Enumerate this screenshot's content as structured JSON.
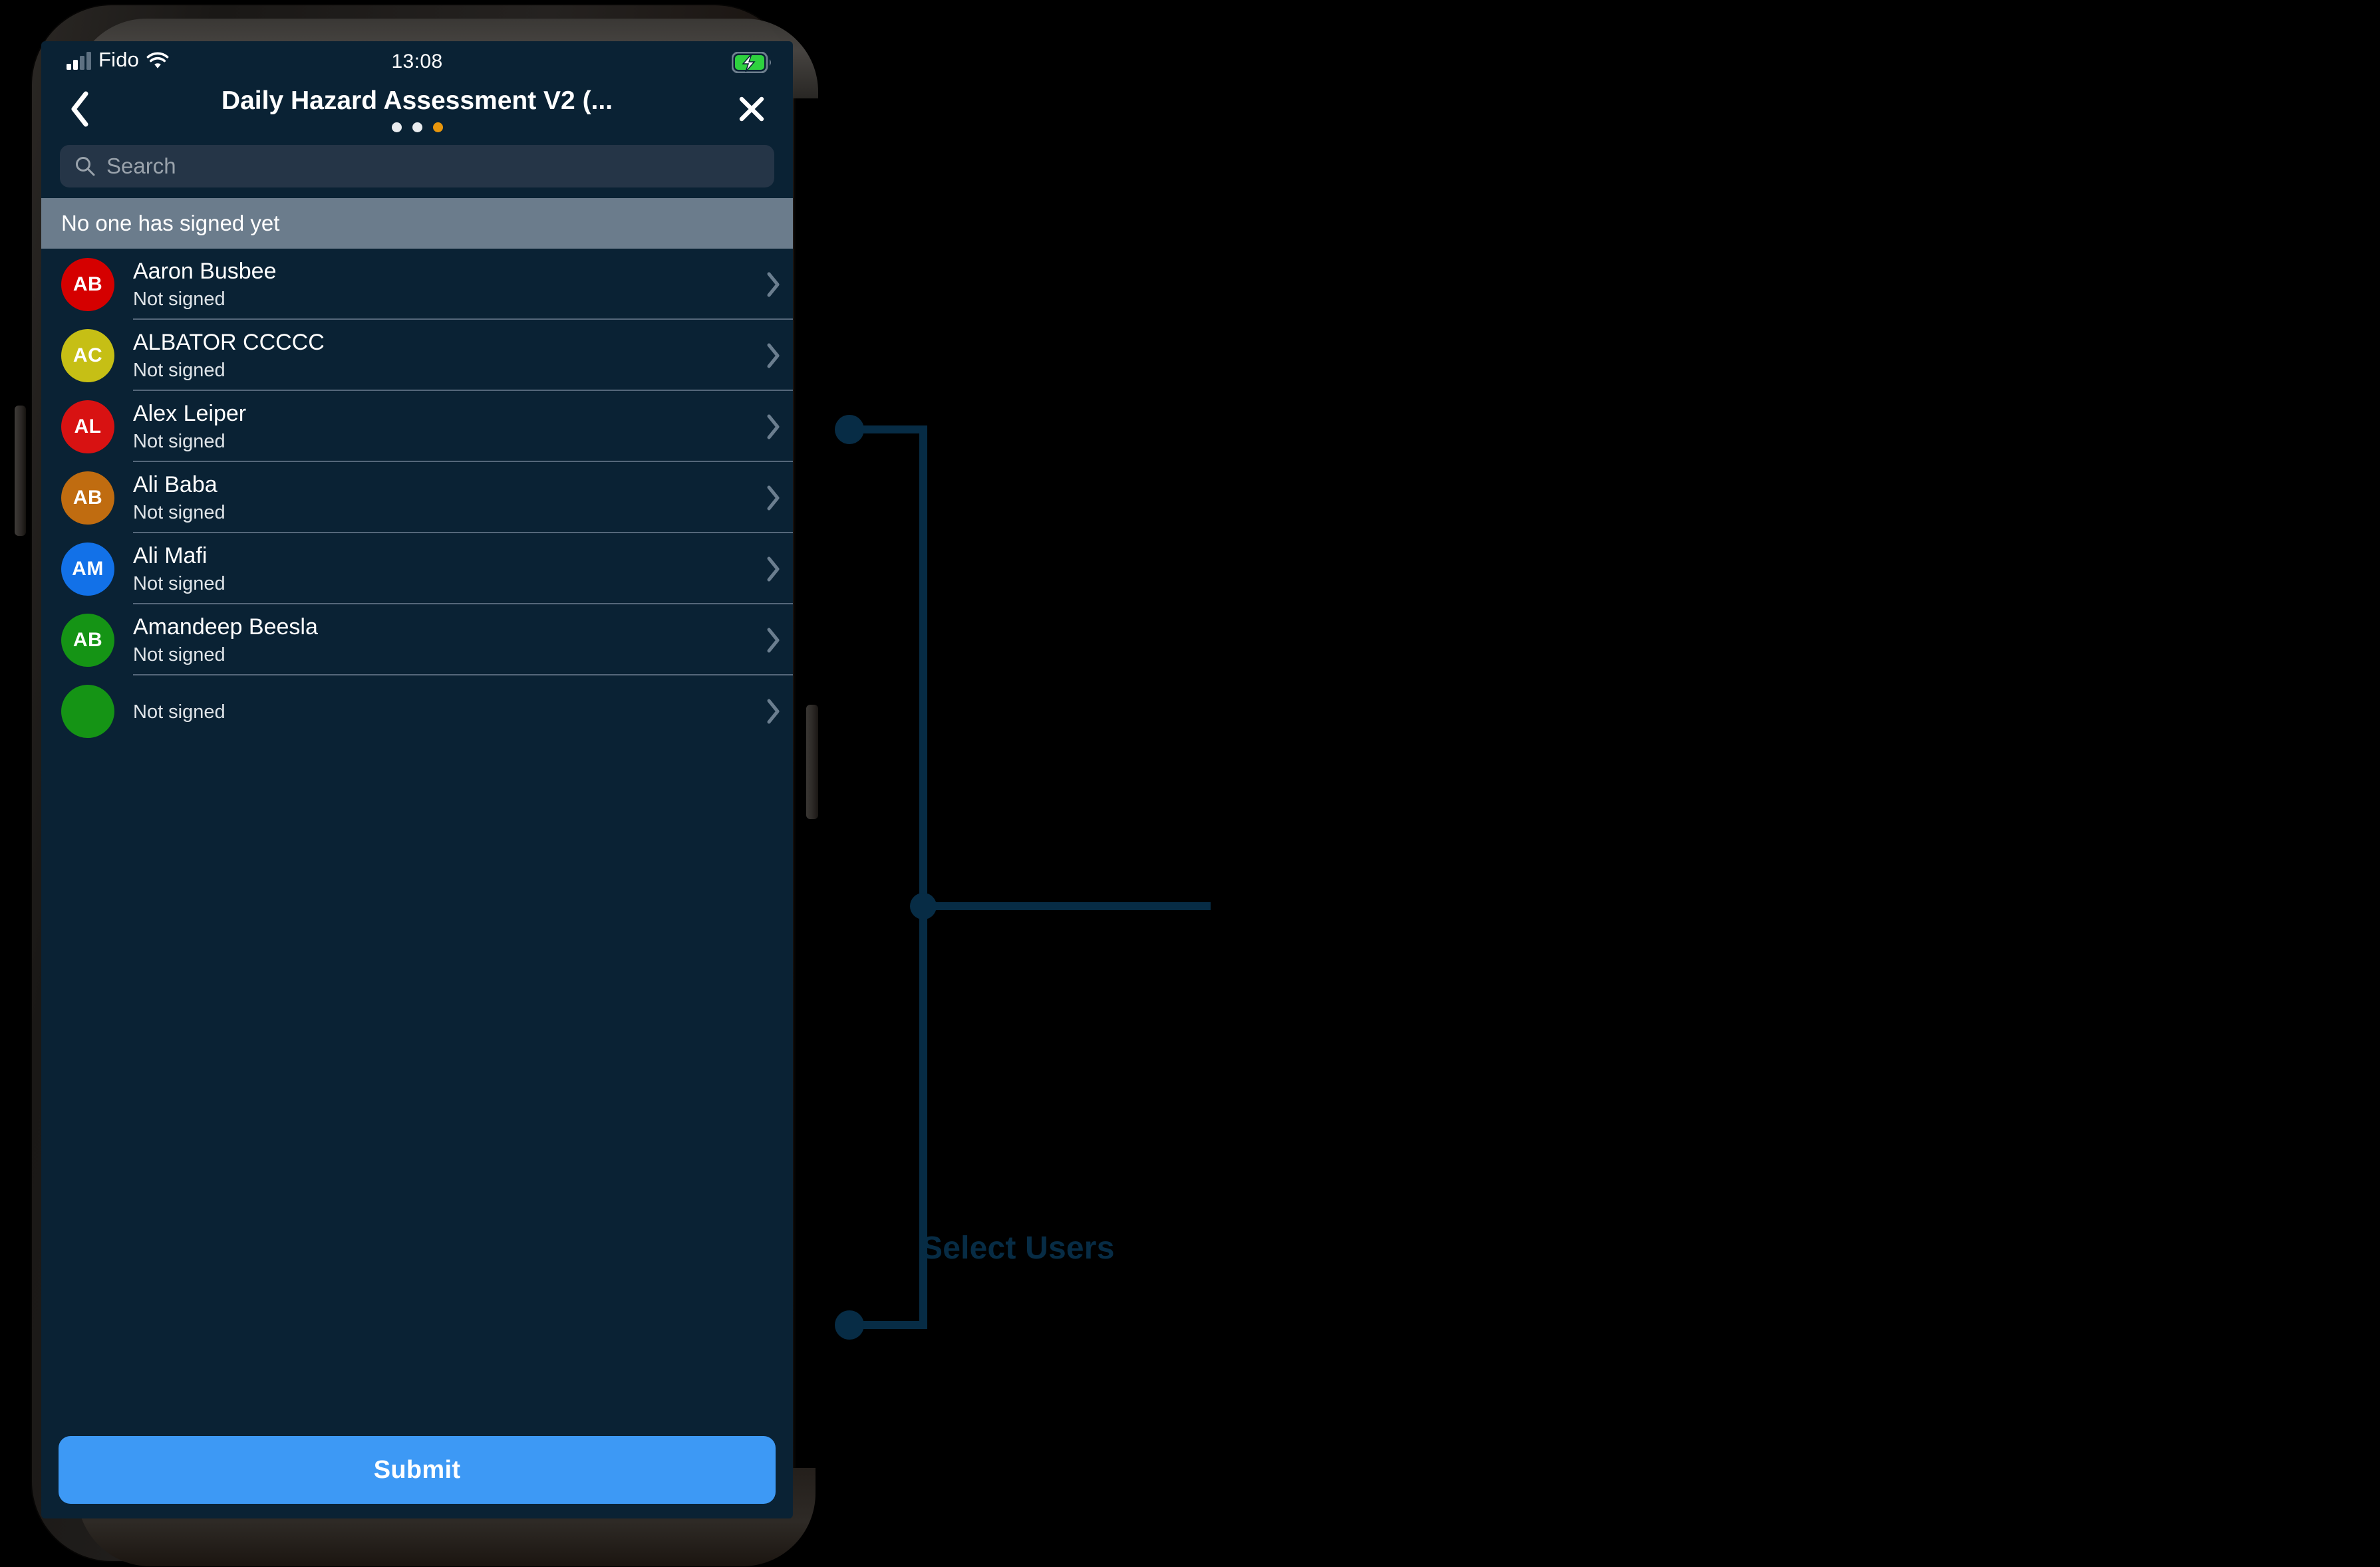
{
  "status_bar": {
    "carrier": "Fido",
    "time": "13:08",
    "signal_icon": "cellular-signal-icon",
    "wifi_icon": "wifi-icon",
    "battery_icon": "battery-charging-icon"
  },
  "header": {
    "back_icon": "chevron-left-icon",
    "title": "Daily Hazard Assessment V2 (...",
    "close_icon": "close-x-icon",
    "pagination": [
      {
        "active": false,
        "color": "#e9ecef"
      },
      {
        "active": false,
        "color": "#e9ecef"
      },
      {
        "active": true,
        "color": "#e8960c"
      }
    ]
  },
  "search": {
    "placeholder": "Search",
    "value": "",
    "icon": "search-icon"
  },
  "section": {
    "header_label": "No one has signed yet"
  },
  "users": [
    {
      "initials": "AB",
      "color": "#d50000",
      "name": "Aaron Busbee",
      "status": "Not signed",
      "chevron": "chevron-right-icon"
    },
    {
      "initials": "AC",
      "color": "#c6bf15",
      "name": "ALBATOR CCCCC",
      "status": "Not signed",
      "chevron": "chevron-right-icon"
    },
    {
      "initials": "AL",
      "color": "#d81212",
      "name": "Alex Leiper",
      "status": "Not signed",
      "chevron": "chevron-right-icon"
    },
    {
      "initials": "AB",
      "color": "#c06c10",
      "name": "Ali Baba",
      "status": "Not signed",
      "chevron": "chevron-right-icon"
    },
    {
      "initials": "AM",
      "color": "#1271e8",
      "name": "Ali Mafi",
      "status": "Not signed",
      "chevron": "chevron-right-icon"
    },
    {
      "initials": "AB",
      "color": "#159415",
      "name": "Amandeep Beesla",
      "status": "Not signed",
      "chevron": "chevron-right-icon"
    },
    {
      "initials": "",
      "color": "#159415",
      "name": "",
      "status": "Not signed",
      "chevron": "chevron-right-icon"
    }
  ],
  "footer": {
    "submit_label": "Submit",
    "submit_color": "#3d99f5"
  },
  "annotation": {
    "label": "Select Users",
    "color": "#072c45"
  }
}
